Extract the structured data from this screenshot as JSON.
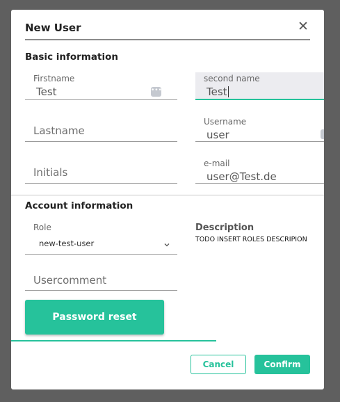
{
  "dialog": {
    "title": "New User",
    "close_icon": "close-icon"
  },
  "basic": {
    "heading": "Basic information",
    "firstname": {
      "label": "Firstname",
      "value": "Test"
    },
    "second_name": {
      "label": "second name",
      "value": "Test"
    },
    "lastname": {
      "placeholder": "Lastname"
    },
    "username": {
      "label": "Username",
      "value": "user"
    },
    "initials": {
      "placeholder": "Initials"
    },
    "email": {
      "label": "e-mail",
      "value": "user@Test.de"
    }
  },
  "account": {
    "heading": "Account information",
    "role": {
      "label": "Role",
      "value": "new-test-user"
    },
    "description": {
      "label": "Description",
      "text": "TODO INSERT ROLES DESCRIPION"
    },
    "usercomment": {
      "placeholder": "Usercomment"
    }
  },
  "actions": {
    "password_reset": "Password reset",
    "cancel": "Cancel",
    "confirm": "Confirm"
  },
  "colors": {
    "accent": "#26c29b",
    "overlay": "#5f5f5f"
  }
}
